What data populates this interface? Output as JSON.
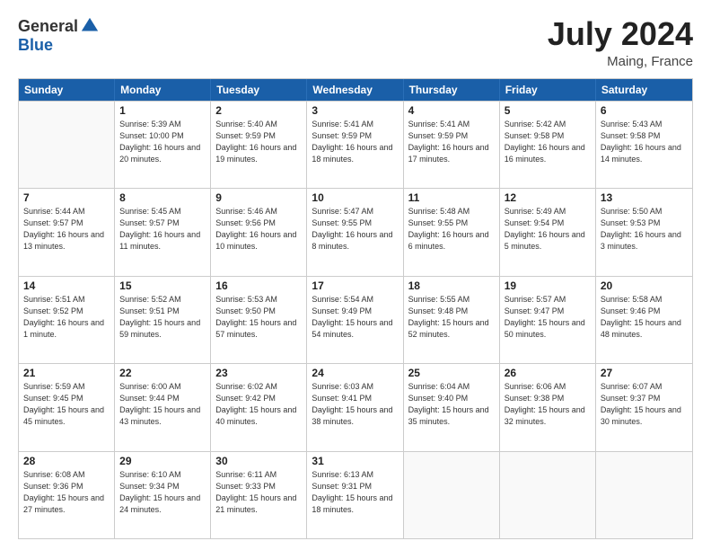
{
  "header": {
    "logo_general": "General",
    "logo_blue": "Blue",
    "month_year": "July 2024",
    "location": "Maing, France"
  },
  "days_of_week": [
    "Sunday",
    "Monday",
    "Tuesday",
    "Wednesday",
    "Thursday",
    "Friday",
    "Saturday"
  ],
  "weeks": [
    [
      {
        "day": "",
        "sunrise": "",
        "sunset": "",
        "daylight": "",
        "empty": true
      },
      {
        "day": "1",
        "sunrise": "Sunrise: 5:39 AM",
        "sunset": "Sunset: 10:00 PM",
        "daylight": "Daylight: 16 hours and 20 minutes."
      },
      {
        "day": "2",
        "sunrise": "Sunrise: 5:40 AM",
        "sunset": "Sunset: 9:59 PM",
        "daylight": "Daylight: 16 hours and 19 minutes."
      },
      {
        "day": "3",
        "sunrise": "Sunrise: 5:41 AM",
        "sunset": "Sunset: 9:59 PM",
        "daylight": "Daylight: 16 hours and 18 minutes."
      },
      {
        "day": "4",
        "sunrise": "Sunrise: 5:41 AM",
        "sunset": "Sunset: 9:59 PM",
        "daylight": "Daylight: 16 hours and 17 minutes."
      },
      {
        "day": "5",
        "sunrise": "Sunrise: 5:42 AM",
        "sunset": "Sunset: 9:58 PM",
        "daylight": "Daylight: 16 hours and 16 minutes."
      },
      {
        "day": "6",
        "sunrise": "Sunrise: 5:43 AM",
        "sunset": "Sunset: 9:58 PM",
        "daylight": "Daylight: 16 hours and 14 minutes."
      }
    ],
    [
      {
        "day": "7",
        "sunrise": "Sunrise: 5:44 AM",
        "sunset": "Sunset: 9:57 PM",
        "daylight": "Daylight: 16 hours and 13 minutes."
      },
      {
        "day": "8",
        "sunrise": "Sunrise: 5:45 AM",
        "sunset": "Sunset: 9:57 PM",
        "daylight": "Daylight: 16 hours and 11 minutes."
      },
      {
        "day": "9",
        "sunrise": "Sunrise: 5:46 AM",
        "sunset": "Sunset: 9:56 PM",
        "daylight": "Daylight: 16 hours and 10 minutes."
      },
      {
        "day": "10",
        "sunrise": "Sunrise: 5:47 AM",
        "sunset": "Sunset: 9:55 PM",
        "daylight": "Daylight: 16 hours and 8 minutes."
      },
      {
        "day": "11",
        "sunrise": "Sunrise: 5:48 AM",
        "sunset": "Sunset: 9:55 PM",
        "daylight": "Daylight: 16 hours and 6 minutes."
      },
      {
        "day": "12",
        "sunrise": "Sunrise: 5:49 AM",
        "sunset": "Sunset: 9:54 PM",
        "daylight": "Daylight: 16 hours and 5 minutes."
      },
      {
        "day": "13",
        "sunrise": "Sunrise: 5:50 AM",
        "sunset": "Sunset: 9:53 PM",
        "daylight": "Daylight: 16 hours and 3 minutes."
      }
    ],
    [
      {
        "day": "14",
        "sunrise": "Sunrise: 5:51 AM",
        "sunset": "Sunset: 9:52 PM",
        "daylight": "Daylight: 16 hours and 1 minute."
      },
      {
        "day": "15",
        "sunrise": "Sunrise: 5:52 AM",
        "sunset": "Sunset: 9:51 PM",
        "daylight": "Daylight: 15 hours and 59 minutes."
      },
      {
        "day": "16",
        "sunrise": "Sunrise: 5:53 AM",
        "sunset": "Sunset: 9:50 PM",
        "daylight": "Daylight: 15 hours and 57 minutes."
      },
      {
        "day": "17",
        "sunrise": "Sunrise: 5:54 AM",
        "sunset": "Sunset: 9:49 PM",
        "daylight": "Daylight: 15 hours and 54 minutes."
      },
      {
        "day": "18",
        "sunrise": "Sunrise: 5:55 AM",
        "sunset": "Sunset: 9:48 PM",
        "daylight": "Daylight: 15 hours and 52 minutes."
      },
      {
        "day": "19",
        "sunrise": "Sunrise: 5:57 AM",
        "sunset": "Sunset: 9:47 PM",
        "daylight": "Daylight: 15 hours and 50 minutes."
      },
      {
        "day": "20",
        "sunrise": "Sunrise: 5:58 AM",
        "sunset": "Sunset: 9:46 PM",
        "daylight": "Daylight: 15 hours and 48 minutes."
      }
    ],
    [
      {
        "day": "21",
        "sunrise": "Sunrise: 5:59 AM",
        "sunset": "Sunset: 9:45 PM",
        "daylight": "Daylight: 15 hours and 45 minutes."
      },
      {
        "day": "22",
        "sunrise": "Sunrise: 6:00 AM",
        "sunset": "Sunset: 9:44 PM",
        "daylight": "Daylight: 15 hours and 43 minutes."
      },
      {
        "day": "23",
        "sunrise": "Sunrise: 6:02 AM",
        "sunset": "Sunset: 9:42 PM",
        "daylight": "Daylight: 15 hours and 40 minutes."
      },
      {
        "day": "24",
        "sunrise": "Sunrise: 6:03 AM",
        "sunset": "Sunset: 9:41 PM",
        "daylight": "Daylight: 15 hours and 38 minutes."
      },
      {
        "day": "25",
        "sunrise": "Sunrise: 6:04 AM",
        "sunset": "Sunset: 9:40 PM",
        "daylight": "Daylight: 15 hours and 35 minutes."
      },
      {
        "day": "26",
        "sunrise": "Sunrise: 6:06 AM",
        "sunset": "Sunset: 9:38 PM",
        "daylight": "Daylight: 15 hours and 32 minutes."
      },
      {
        "day": "27",
        "sunrise": "Sunrise: 6:07 AM",
        "sunset": "Sunset: 9:37 PM",
        "daylight": "Daylight: 15 hours and 30 minutes."
      }
    ],
    [
      {
        "day": "28",
        "sunrise": "Sunrise: 6:08 AM",
        "sunset": "Sunset: 9:36 PM",
        "daylight": "Daylight: 15 hours and 27 minutes."
      },
      {
        "day": "29",
        "sunrise": "Sunrise: 6:10 AM",
        "sunset": "Sunset: 9:34 PM",
        "daylight": "Daylight: 15 hours and 24 minutes."
      },
      {
        "day": "30",
        "sunrise": "Sunrise: 6:11 AM",
        "sunset": "Sunset: 9:33 PM",
        "daylight": "Daylight: 15 hours and 21 minutes."
      },
      {
        "day": "31",
        "sunrise": "Sunrise: 6:13 AM",
        "sunset": "Sunset: 9:31 PM",
        "daylight": "Daylight: 15 hours and 18 minutes."
      },
      {
        "day": "",
        "sunrise": "",
        "sunset": "",
        "daylight": "",
        "empty": true
      },
      {
        "day": "",
        "sunrise": "",
        "sunset": "",
        "daylight": "",
        "empty": true
      },
      {
        "day": "",
        "sunrise": "",
        "sunset": "",
        "daylight": "",
        "empty": true
      }
    ]
  ]
}
